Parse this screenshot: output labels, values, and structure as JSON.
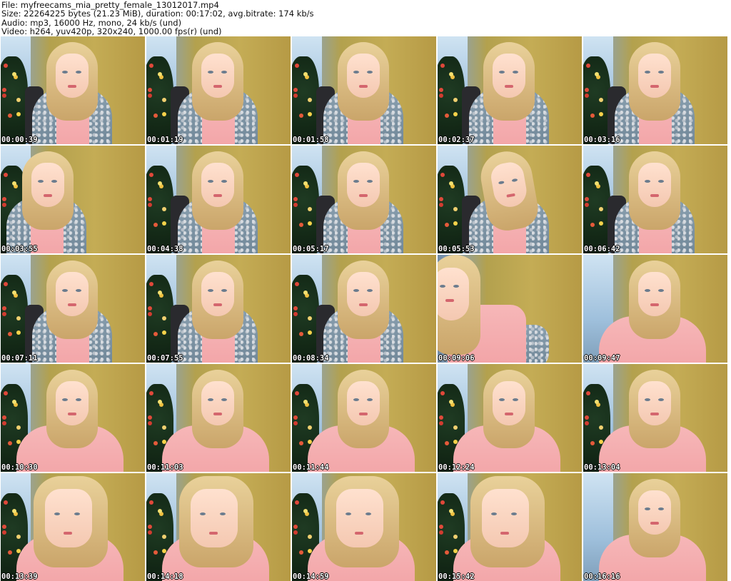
{
  "header": {
    "file_line": "File: myfreecams_mia_pretty_female_13012017.mp4",
    "size_line": "Size: 22264225 bytes (21.23 MiB), duration: 00:17:02, avg.bitrate: 174 kb/s",
    "audio_line": "Audio: mp3, 16000 Hz, mono, 24 kb/s (und)",
    "video_line": "Video: h264, yuv420p, 320x240, 1000.00 fps(r) (und)"
  },
  "thumbnails": [
    {
      "timestamp": "00:00:39"
    },
    {
      "timestamp": "00:01:19"
    },
    {
      "timestamp": "00:01:58"
    },
    {
      "timestamp": "00:02:37"
    },
    {
      "timestamp": "00:03:16"
    },
    {
      "timestamp": "00:03:55"
    },
    {
      "timestamp": "00:04:38"
    },
    {
      "timestamp": "00:05:17"
    },
    {
      "timestamp": "00:05:53"
    },
    {
      "timestamp": "00:06:42"
    },
    {
      "timestamp": "00:07:11"
    },
    {
      "timestamp": "00:07:55"
    },
    {
      "timestamp": "00:08:34"
    },
    {
      "timestamp": "00:09:06"
    },
    {
      "timestamp": "00:09:47"
    },
    {
      "timestamp": "00:10:30"
    },
    {
      "timestamp": "00:11:03"
    },
    {
      "timestamp": "00:11:44"
    },
    {
      "timestamp": "00:12:24"
    },
    {
      "timestamp": "00:13:04"
    },
    {
      "timestamp": "00:13:39"
    },
    {
      "timestamp": "00:14:18"
    },
    {
      "timestamp": "00:14:59"
    },
    {
      "timestamp": "00:15:42"
    },
    {
      "timestamp": "00:16:16"
    }
  ]
}
